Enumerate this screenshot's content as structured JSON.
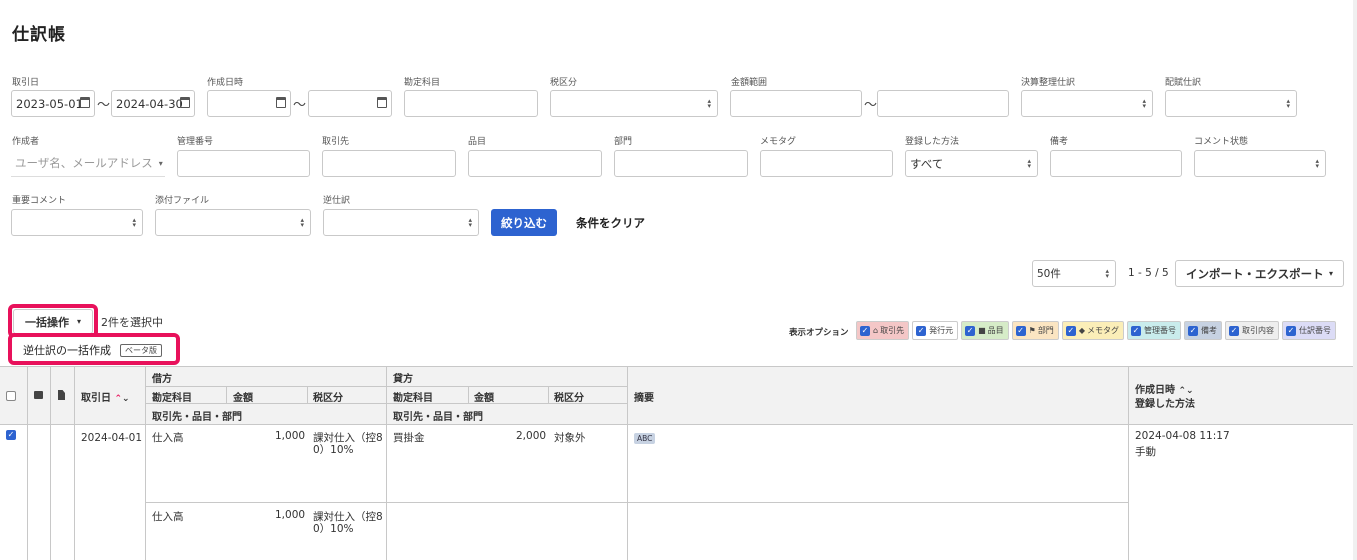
{
  "page": {
    "title": "仕訳帳"
  },
  "filters": {
    "row1": {
      "deal_date_label": "取引日",
      "deal_date_from": "2023-05-01",
      "deal_date_to": "2024-04-30",
      "created_label": "作成日時",
      "account_label": "勘定科目",
      "tax_label": "税区分",
      "amount_label": "金額範囲",
      "closing_label": "決算整理仕訳",
      "allocation_label": "配賦仕訳"
    },
    "row2": {
      "creator_label": "作成者",
      "creator_placeholder": "ユーザ名、メールアドレス",
      "mgmt_label": "管理番号",
      "partner_label": "取引先",
      "item_label": "品目",
      "dept_label": "部門",
      "memo_label": "メモタグ",
      "method_label": "登録した方法",
      "method_value": "すべて",
      "note_label": "備考",
      "comment_label": "コメント状態"
    },
    "row3": {
      "important_label": "重要コメント",
      "attach_label": "添付ファイル",
      "reverse_label": "逆仕訳",
      "submit_label": "絞り込む",
      "clear_label": "条件をクリア"
    },
    "tilde": "〜"
  },
  "pagination": {
    "per_page": "50件",
    "range": "1 - 5 / 5",
    "import_export": "インポート・エクスポート"
  },
  "bulk": {
    "button": "一括操作",
    "selected": "2件を選択中",
    "menu_item": "逆仕訳の一括作成",
    "beta": "ベータ版"
  },
  "display_options": {
    "label": "表示オプション",
    "chips": [
      {
        "label": "取引先",
        "icon": "home-icon",
        "bg": "#f4c7c7"
      },
      {
        "label": "発行元",
        "icon": "",
        "bg": "#ffffff"
      },
      {
        "label": "品目",
        "icon": "box-icon",
        "bg": "#d6ecc8"
      },
      {
        "label": "部門",
        "icon": "flag-icon",
        "bg": "#fbe5c2"
      },
      {
        "label": "メモタグ",
        "icon": "tag-icon",
        "bg": "#fbeeb8"
      },
      {
        "label": "管理番号",
        "icon": "",
        "bg": "#c9ecec"
      },
      {
        "label": "備考",
        "icon": "",
        "bg": "#c7d2e2"
      },
      {
        "label": "取引内容",
        "icon": "",
        "bg": "#eeeeee"
      },
      {
        "label": "仕訳番号",
        "icon": "",
        "bg": "#dcdcf6"
      }
    ]
  },
  "table": {
    "headers": {
      "deal_date": "取引日",
      "debit": "借方",
      "credit": "貸方",
      "account": "勘定科目",
      "amount": "金額",
      "tax": "税区分",
      "partner_item_dept": "取引先・品目・部門",
      "summary": "摘要",
      "created": "作成日時",
      "method": "登録した方法"
    },
    "rows": [
      {
        "date": "2024-04-01",
        "debit_account": "仕入高",
        "debit_amount": "1,000",
        "debit_tax_1": "課対仕入（控8",
        "debit_tax_2": "0）10%",
        "credit_account": "買掛金",
        "credit_amount": "2,000",
        "credit_tax": "対象外",
        "tag": "ABC",
        "created": "2024-04-08 11:17",
        "method": "手動",
        "debit2_account": "仕入高",
        "debit2_amount": "1,000",
        "debit2_tax_1": "課対仕入（控8",
        "debit2_tax_2": "0）10%"
      }
    ]
  }
}
